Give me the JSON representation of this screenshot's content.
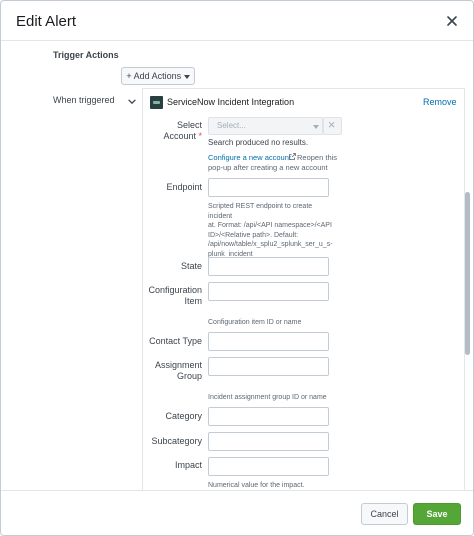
{
  "modal": {
    "title": "Edit Alert"
  },
  "trigger": {
    "section_label": "Trigger Actions",
    "add_actions_label": "+ Add Actions",
    "when_label": "When triggered"
  },
  "action": {
    "name": "ServiceNow Incident Integration",
    "remove_label": "Remove"
  },
  "form": {
    "account": {
      "label_line1": "Select",
      "label_line2": "Account",
      "required_mark": "*",
      "placeholder": "Select...",
      "no_results": "Search produced no results.",
      "configure_link": "Configure a new account",
      "reopen_line1": "Reopen this",
      "reopen_line2": "pop-up after creating a new account"
    },
    "endpoint": {
      "label": "Endpoint",
      "value": "",
      "help": [
        "Scripted REST endpoint to create incident",
        "at. Format: /api/<API namespace>/<API",
        "ID>/<Relative path>. Default:",
        "/api/now/table/x_splu2_splunk_ser_u_s-",
        "plunk_incident"
      ]
    },
    "state": {
      "label": "State",
      "value": ""
    },
    "configuration_item": {
      "label_line1": "Configuration",
      "label_line2": "Item",
      "value": "",
      "help": "Configuration item ID or name"
    },
    "contact_type": {
      "label": "Contact Type",
      "value": ""
    },
    "assignment_group": {
      "label_line1": "Assignment",
      "label_line2": "Group",
      "value": "",
      "help": "Incident assignment group ID or name"
    },
    "category": {
      "label": "Category",
      "value": ""
    },
    "subcategory": {
      "label": "Subcategory",
      "value": ""
    },
    "impact": {
      "label": "Impact",
      "value": "",
      "help": "Numerical value for the impact."
    }
  },
  "footer": {
    "cancel_label": "Cancel",
    "save_label": "Save"
  },
  "colors": {
    "link": "#006eaa",
    "save_green": "#54a736",
    "required_red": "#dc4e41"
  }
}
